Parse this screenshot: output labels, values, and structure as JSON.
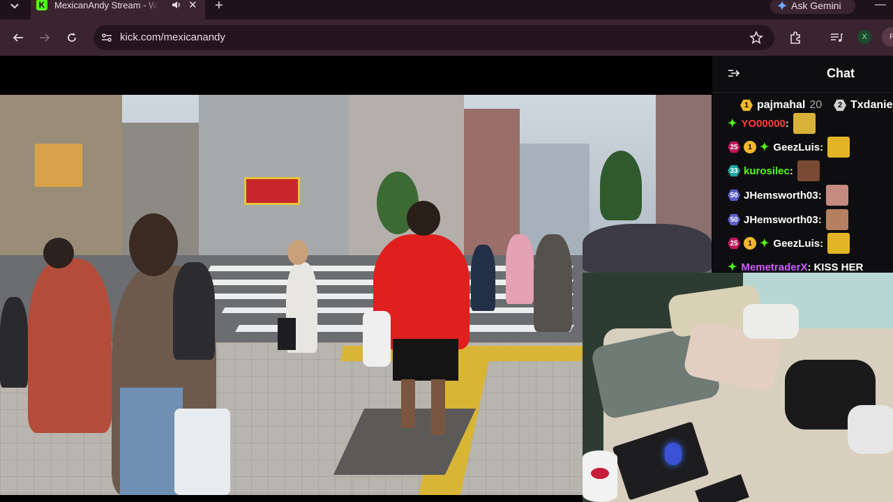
{
  "browser": {
    "tab": {
      "title": "MexicanAndy Stream - Watch",
      "favicon_letter": "K"
    },
    "url": "kick.com/mexicanandy",
    "gemini_label": "Ask Gemini",
    "profile_x": "X",
    "profile_f": "F",
    "icons": [
      "tab-list-icon",
      "audio-icon",
      "close-icon",
      "plus-icon",
      "back-arrow-icon",
      "forward-arrow-icon",
      "reload-icon",
      "site-info-icon",
      "star-icon",
      "extensions-icon",
      "media-controls-icon",
      "minimize-icon",
      "gemini-sparkle-icon"
    ]
  },
  "chat": {
    "title": "Chat",
    "leaderboard": [
      {
        "rank": "1",
        "name": "pajmahal",
        "count": "20",
        "color": "#f5b82a"
      },
      {
        "rank": "2",
        "name": "Txdaniel",
        "count": "",
        "color": "#cfcfcf"
      }
    ],
    "messages": [
      {
        "badges": [],
        "sparkle": true,
        "user": "YO00000",
        "user_color": "#ff3b3b",
        "text": "",
        "emote": "sunglasses"
      },
      {
        "badges": [
          {
            "t": "hex",
            "v": "25",
            "c": "#c2185b"
          },
          {
            "t": "round",
            "v": "1"
          }
        ],
        "sparkle": true,
        "user": "GeezLuis",
        "user_color": "#ffffff",
        "text": "",
        "emote": "face-gold"
      },
      {
        "badges": [
          {
            "t": "hex",
            "v": "33",
            "c": "#1fa3a3"
          }
        ],
        "sparkle": false,
        "user": "kurosilec",
        "user_color": "#53fc18",
        "text": "",
        "emote": "face-brown"
      },
      {
        "badges": [
          {
            "t": "hex",
            "v": "50",
            "c": "#5b5fc7"
          }
        ],
        "sparkle": false,
        "user": "JHemsworth03",
        "user_color": "#ffffff",
        "text": "",
        "emote": "lips"
      },
      {
        "badges": [
          {
            "t": "hex",
            "v": "50",
            "c": "#5b5fc7"
          }
        ],
        "sparkle": false,
        "user": "JHemsworth03",
        "user_color": "#ffffff",
        "text": "",
        "emote": "man-face"
      },
      {
        "badges": [
          {
            "t": "hex",
            "v": "25",
            "c": "#c2185b"
          },
          {
            "t": "round",
            "v": "1"
          }
        ],
        "sparkle": true,
        "user": "GeezLuis",
        "user_color": "#ffffff",
        "text": "",
        "emote": "face-gold"
      },
      {
        "badges": [],
        "sparkle": true,
        "user": "MemetraderX",
        "user_color": "#d05cff",
        "text": "KISS HER",
        "emote": ""
      }
    ]
  },
  "colors": {
    "kick_green": "#53fc18",
    "chrome_bg": "#3a2430",
    "chat_bg": "#0e0e10"
  }
}
